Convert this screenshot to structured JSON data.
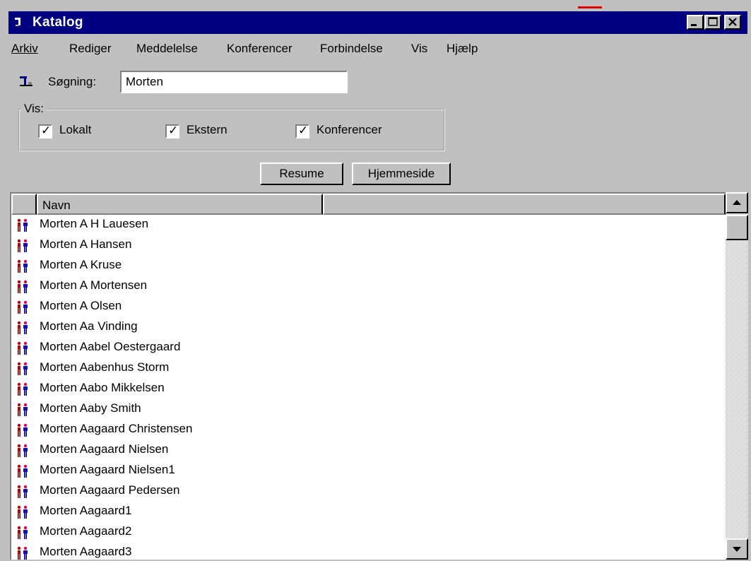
{
  "window": {
    "title": "Katalog",
    "title_icon": "app-icon"
  },
  "title_buttons": {
    "minimize_icon": "minimize-icon",
    "maximize_icon": "maximize-icon",
    "close_icon": "close-icon"
  },
  "menu": [
    {
      "label": "Arkiv"
    },
    {
      "label": "Rediger"
    },
    {
      "label": "Meddelelse"
    },
    {
      "label": "Konferencer"
    },
    {
      "label": "Forbindelse"
    },
    {
      "label": "Vis"
    },
    {
      "label": "Hjælp"
    }
  ],
  "search": {
    "label": "Søgning:",
    "value": "Morten",
    "icon": "search-icon"
  },
  "filter": {
    "legend": "Vis:",
    "options": [
      {
        "label": "Lokalt",
        "checked": true
      },
      {
        "label": "Ekstern",
        "checked": true
      },
      {
        "label": "Konferencer",
        "checked": true
      }
    ]
  },
  "buttons": {
    "resume": "Resume",
    "homepage": "Hjemmeside"
  },
  "list": {
    "column_header": "Navn",
    "row_icon": "users-icon",
    "items": [
      "Morten A H Lauesen",
      "Morten A Hansen",
      "Morten A Kruse",
      "Morten A Mortensen",
      "Morten A Olsen",
      "Morten Aa Vinding",
      "Morten Aabel Oestergaard",
      "Morten Aabenhus Storm",
      "Morten Aabo Mikkelsen",
      "Morten Aaby Smith",
      "Morten Aagaard Christensen",
      "Morten Aagaard Nielsen",
      "Morten Aagaard Nielsen1",
      "Morten Aagaard Pedersen",
      "Morten Aagaard1",
      "Morten Aagaard2",
      "Morten Aagaard3"
    ]
  },
  "colors": {
    "titlebar": "#000080",
    "face": "#c0c0c0",
    "list_bg": "#ffffff"
  }
}
